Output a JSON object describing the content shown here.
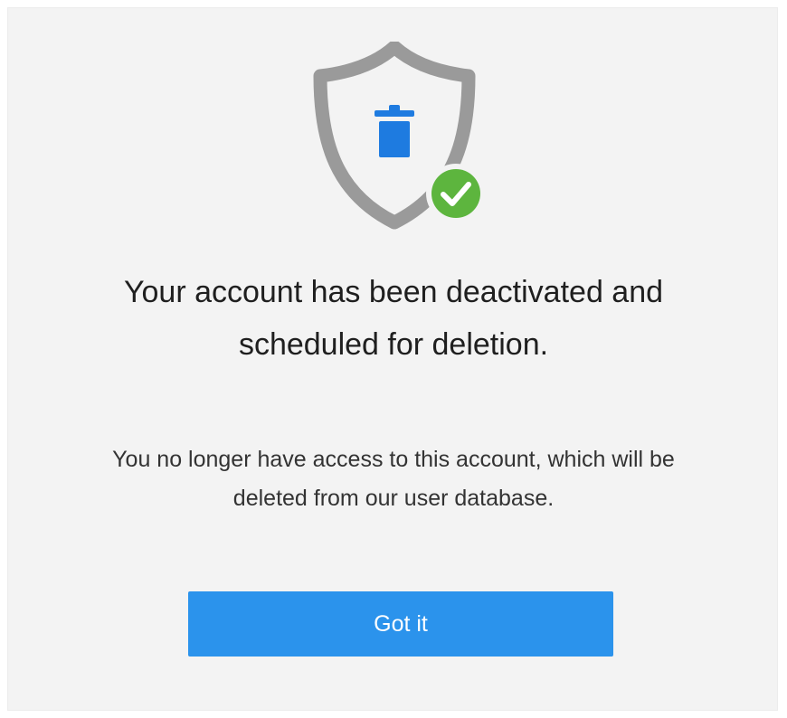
{
  "dialog": {
    "title_line1": "Your account has been deactivated and",
    "title_line2": "scheduled for deletion.",
    "message_line1": "You no longer have access to this account, which will be",
    "message_line2": "deleted from our user database.",
    "button_label": "Got it"
  },
  "icons": {
    "shield": "shield-icon",
    "trash": "trash-icon",
    "check": "check-badge-icon"
  },
  "colors": {
    "shield": "#9a9a9a",
    "trash": "#1e7be0",
    "check_badge": "#5db53e",
    "button": "#2b93ec",
    "button_text": "#ffffff",
    "background": "#f3f3f3"
  }
}
